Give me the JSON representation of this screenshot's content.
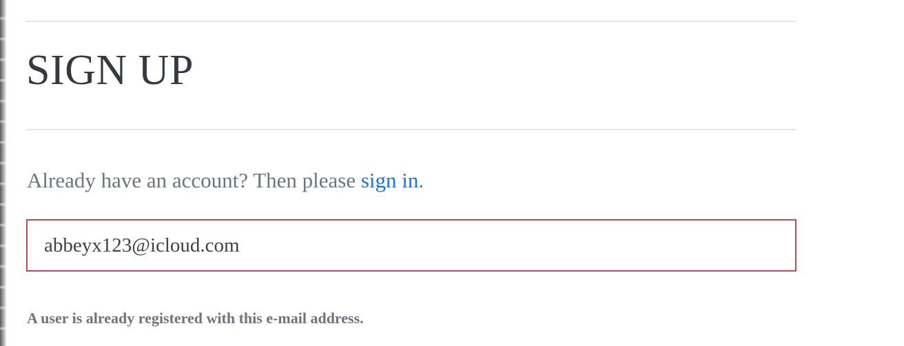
{
  "page": {
    "title": "SIGN UP"
  },
  "signin_prompt": {
    "text_before": "Already have an account? Then please ",
    "link_label": "sign in",
    "text_after": "."
  },
  "form": {
    "email_value": "abbeyx123@icloud.com",
    "error_message": "A user is already registered with this e-mail address."
  },
  "colors": {
    "title": "#343a40",
    "muted_text": "#6c757d",
    "link": "#1a73e8",
    "error_border": "#c5474f",
    "divider": "#e4e5e7"
  }
}
